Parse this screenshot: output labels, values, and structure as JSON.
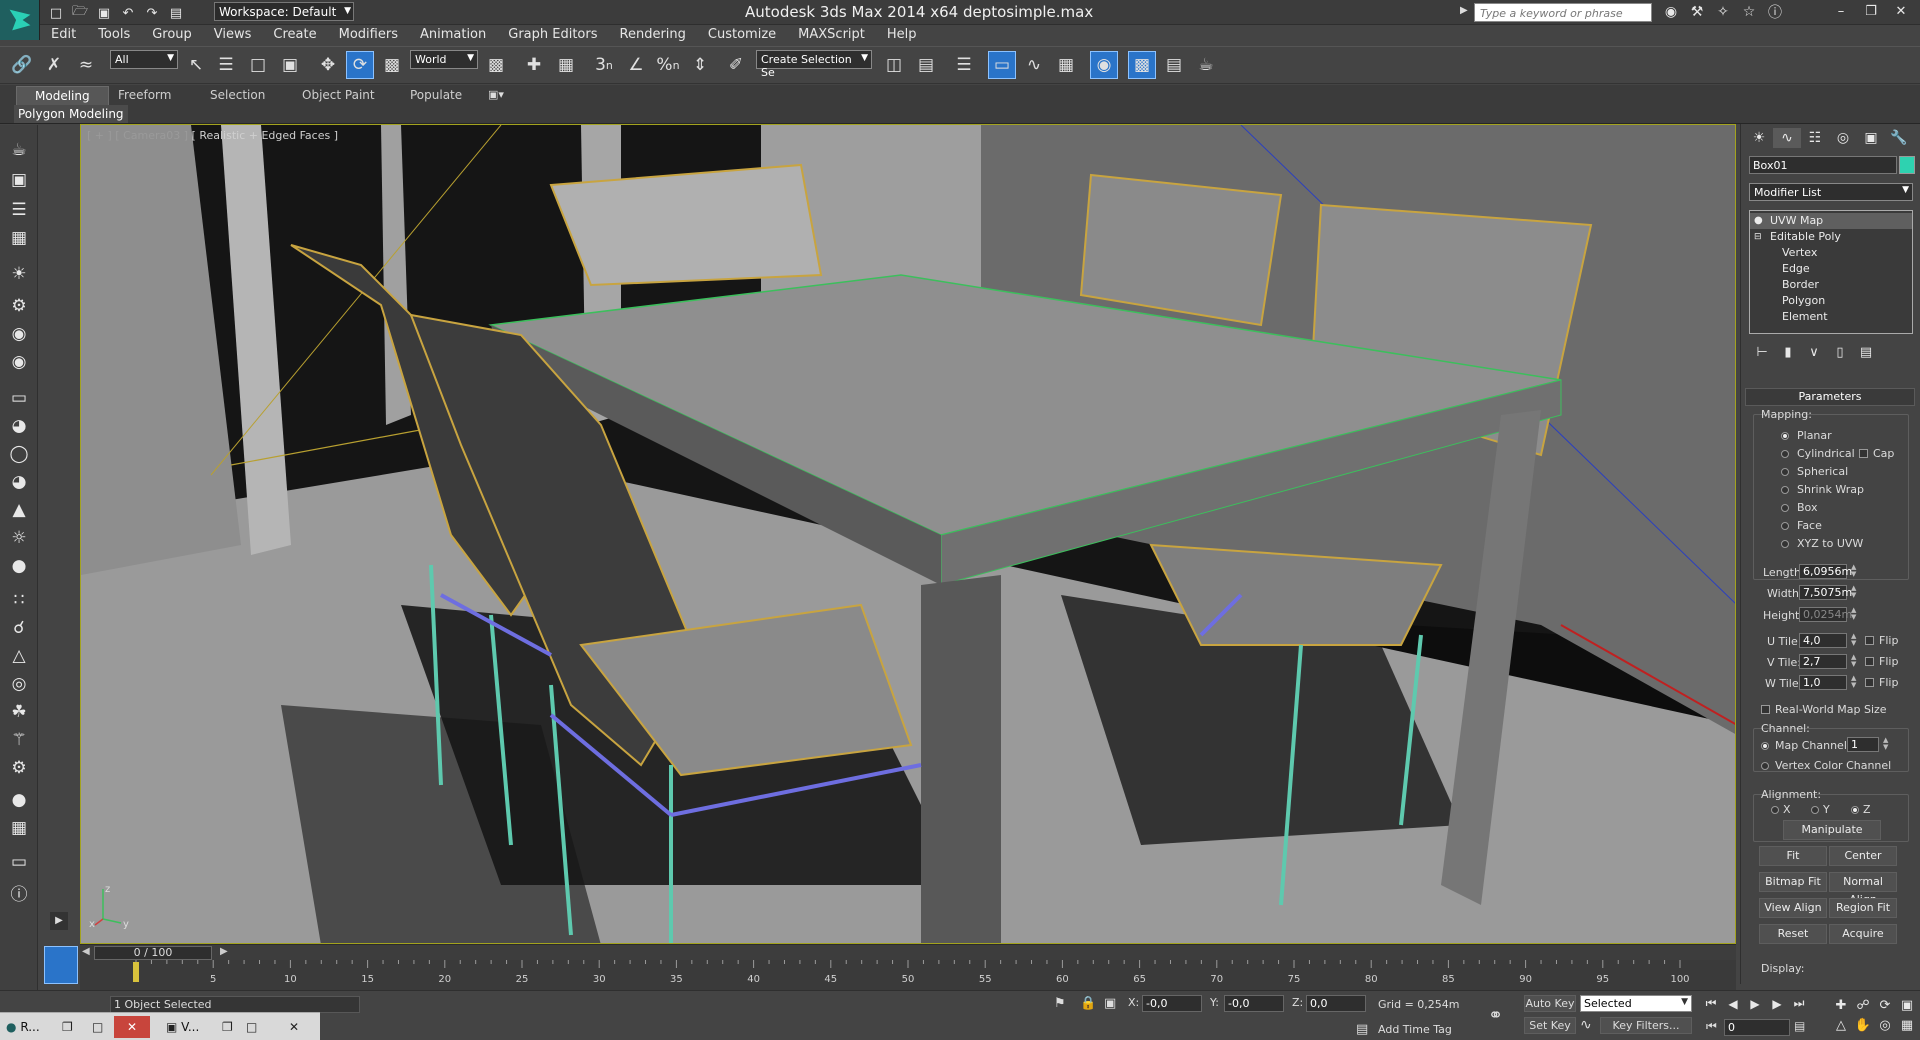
{
  "titlebar": {
    "title": "Autodesk 3ds Max  2014 x64      deptosimple.max",
    "workspace": "Workspace: Default",
    "search_placeholder": "Type a keyword or phrase",
    "qat_icons": [
      "new-file-icon",
      "open-folder-icon",
      "save-icon",
      "undo-icon",
      "redo-icon",
      "project-folder-icon"
    ],
    "info_icons": [
      "infocenter-icon",
      "tools-icon",
      "communication-icon",
      "favorites-icon",
      "help-icon"
    ],
    "window_buttons": [
      "minimize-icon",
      "restore-icon",
      "close-icon"
    ]
  },
  "menu": [
    "Edit",
    "Tools",
    "Group",
    "Views",
    "Create",
    "Modifiers",
    "Animation",
    "Graph Editors",
    "Rendering",
    "Customize",
    "MAXScript",
    "Help"
  ],
  "main_toolbar": {
    "selection_filter": "All",
    "reference_coord": "World",
    "named_selection": "Create Selection Se",
    "snap_labels": [
      "3",
      "n",
      "%",
      "n"
    ]
  },
  "ribbon": {
    "tabs": [
      "Modeling",
      "Freeform",
      "Selection",
      "Object Paint",
      "Populate"
    ],
    "active_tab": "Modeling",
    "panel": "Polygon Modeling"
  },
  "viewport": {
    "label_bracket": "[ + ] [ Camera03 ]",
    "label_mode": "[ Realistic + Edged Faces ]",
    "axis": {
      "x": "x",
      "y": "y",
      "z": "z"
    }
  },
  "command_panel": {
    "object_name": "Box01",
    "object_color": "#2ed2b0",
    "modifier_list": "Modifier List",
    "stack": [
      "UVW Map",
      "Editable Poly",
      "Vertex",
      "Edge",
      "Border",
      "Polygon",
      "Element"
    ],
    "rollout_title": "Parameters",
    "mapping_label": "Mapping:",
    "mapping_options": [
      "Planar",
      "Cylindrical",
      "Spherical",
      "Shrink Wrap",
      "Box",
      "Face",
      "XYZ to UVW"
    ],
    "mapping_selected": "Planar",
    "cap_label": "Cap",
    "length_label": "Length:",
    "length_value": "6,0956m",
    "width_label": "Width:",
    "width_value": "7,5075m",
    "height_label": "Height:",
    "height_value": "0,0254m",
    "utile_label": "U Tile:",
    "utile_value": "4,0",
    "vtile_label": "V Tile:",
    "vtile_value": "2,7",
    "wtile_label": "W Tile:",
    "wtile_value": "1,0",
    "flip_label": "Flip",
    "realworld_label": "Real-World Map Size",
    "channel_label": "Channel:",
    "map_channel_label": "Map Channel:",
    "map_channel_value": "1",
    "vertex_color_label": "Vertex Color Channel",
    "alignment_label": "Alignment:",
    "align_axes": [
      "X",
      "Y",
      "Z"
    ],
    "align_selected": "Z",
    "buttons": {
      "manipulate": "Manipulate",
      "fit": "Fit",
      "center": "Center",
      "bitmap_fit": "Bitmap Fit",
      "normal_align": "Normal Align",
      "view_align": "View Align",
      "region_fit": "Region Fit",
      "reset": "Reset",
      "acquire": "Acquire"
    },
    "display_label": "Display:"
  },
  "timeline": {
    "slider": "0 / 100",
    "ticks": [
      "5",
      "10",
      "15",
      "20",
      "25",
      "30",
      "35",
      "40",
      "45",
      "50",
      "55",
      "60",
      "65",
      "70",
      "75",
      "80",
      "85",
      "90",
      "95",
      "100"
    ]
  },
  "status": {
    "selection": "1 Object Selected",
    "x_label": "X:",
    "x_value": "-0,0",
    "y_label": "Y:",
    "y_value": "-0,0",
    "z_label": "Z:",
    "z_value": "0,0",
    "grid": "Grid = 0,254m",
    "add_time_tag": "Add Time Tag",
    "auto_key": "Auto Key",
    "key_mode": "Selected",
    "set_key": "Set Key",
    "key_filters": "Key Filters...",
    "frame": "0"
  },
  "taskbar": {
    "task1": "R...",
    "task2": "V..."
  }
}
